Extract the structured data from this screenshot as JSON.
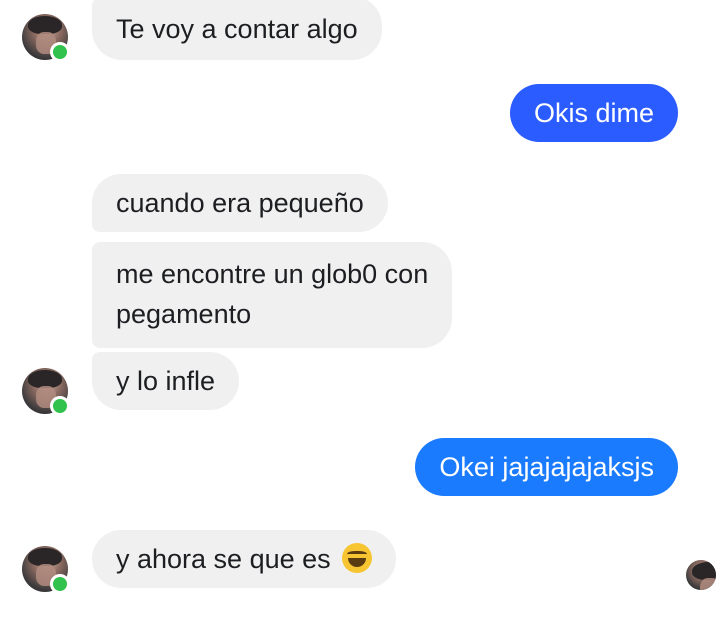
{
  "conversation": {
    "messages": [
      {
        "sender": "them",
        "text": "Te voy a contar algo"
      },
      {
        "sender": "me",
        "text": "Okis dime"
      },
      {
        "sender": "them",
        "text": "cuando era pequeño"
      },
      {
        "sender": "them",
        "text": "me encontre un glob0 con"
      },
      {
        "sender": "them",
        "text": "pegamento"
      },
      {
        "sender": "them",
        "text": "y lo infle"
      },
      {
        "sender": "me",
        "text": "Okei jajajajajaksjs"
      },
      {
        "sender": "them",
        "text": "y ahora se que es",
        "emoji": "grinning-squinting-face"
      }
    ]
  },
  "colors": {
    "incoming_bubble": "#f0f0f0",
    "outgoing_bubble_1": "#2b5cff",
    "outgoing_bubble_2": "#1a7bff",
    "online_dot": "#31c24d"
  }
}
